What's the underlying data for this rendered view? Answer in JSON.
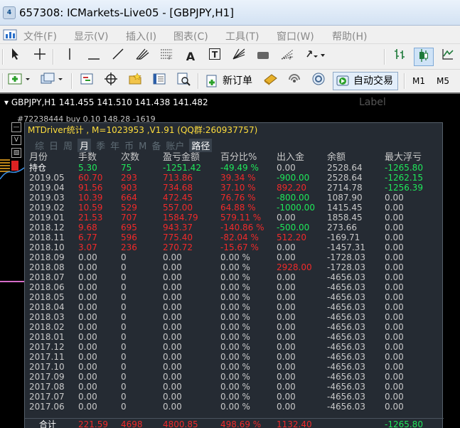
{
  "window": {
    "title": "657308: ICMarkets-Live05 - [GBPJPY,H1]",
    "app_icon_text": "4"
  },
  "menu": {
    "items": [
      "文件(F)",
      "显示(V)",
      "插入(I)",
      "图表(C)",
      "工具(T)",
      "窗口(W)",
      "帮助(H)"
    ]
  },
  "toolbar1": {
    "tools": [
      "cursor",
      "crosshair",
      "vertical-line",
      "horizontal-line",
      "trendline",
      "andrews-pitchfork",
      "fibo-retracement",
      "text",
      "text-label",
      "gann-fan",
      "rectangle",
      "fibo-fan",
      "arrow-menu",
      "bar-chart",
      "candlestick-chart",
      "line-chart"
    ]
  },
  "toolbar2": {
    "new_order_label": "新订单",
    "auto_trading_label": "自动交易",
    "timeframes": [
      "M1",
      "M5"
    ]
  },
  "chart": {
    "symbol_header": "GBPJPY,H1  141.455 141.510 141.438 141.482",
    "watermark": "Label",
    "order_line": "#72238444 buy 0.10          148.28 -1619",
    "ctrl_boxes": [
      "—",
      "V",
      "▧"
    ]
  },
  "panel": {
    "title": "MTDriver统计 , M=1023953 ,V1.91 (QQ群:260937757)",
    "tabs": [
      "综",
      "日",
      "周",
      "月",
      "季",
      "年",
      "币",
      "M",
      "备",
      "账户",
      "路径"
    ],
    "active_tab": "月",
    "columns": [
      "月份",
      "手数",
      "次数",
      "盈亏金额",
      "百分比%",
      "出入金",
      "余额",
      "最大浮亏"
    ],
    "colors": {
      "green": "#1fe85a",
      "red": "#f02a2a",
      "white": "#ffffff",
      "gray": "#c9c9c9"
    },
    "rows": [
      {
        "cells": [
          "持仓",
          "5.30",
          "75",
          "-1251.42",
          "-49.49 %",
          "0.00",
          "2528.64",
          "-1265.80"
        ],
        "colors": [
          "white",
          "green",
          "green",
          "green",
          "green",
          "gray",
          "gray",
          "green"
        ]
      },
      {
        "cells": [
          "2019.05",
          "60.70",
          "293",
          "713.86",
          "39.34 %",
          "-900.00",
          "2528.64",
          "-1262.15"
        ],
        "colors": [
          "gray",
          "red",
          "red",
          "red",
          "red",
          "green",
          "gray",
          "green"
        ]
      },
      {
        "cells": [
          "2019.04",
          "91.56",
          "903",
          "734.68",
          "37.10 %",
          "892.20",
          "2714.78",
          "-1256.39"
        ],
        "colors": [
          "gray",
          "red",
          "red",
          "red",
          "red",
          "red",
          "gray",
          "green"
        ]
      },
      {
        "cells": [
          "2019.03",
          "10.39",
          "664",
          "472.45",
          "76.76 %",
          "-800.00",
          "1087.90",
          "0.00"
        ],
        "colors": [
          "gray",
          "red",
          "red",
          "red",
          "red",
          "green",
          "gray",
          "gray"
        ]
      },
      {
        "cells": [
          "2019.02",
          "10.59",
          "529",
          "557.00",
          "64.88 %",
          "-1000.00",
          "1415.45",
          "0.00"
        ],
        "colors": [
          "gray",
          "red",
          "red",
          "red",
          "red",
          "green",
          "gray",
          "gray"
        ]
      },
      {
        "cells": [
          "2019.01",
          "21.53",
          "707",
          "1584.79",
          "579.11 %",
          "0.00",
          "1858.45",
          "0.00"
        ],
        "colors": [
          "gray",
          "red",
          "red",
          "red",
          "red",
          "gray",
          "gray",
          "gray"
        ]
      },
      {
        "cells": [
          "2018.12",
          "9.68",
          "695",
          "943.37",
          "-140.86 %",
          "-500.00",
          "273.66",
          "0.00"
        ],
        "colors": [
          "gray",
          "red",
          "red",
          "red",
          "red",
          "green",
          "gray",
          "gray"
        ]
      },
      {
        "cells": [
          "2018.11",
          "6.77",
          "596",
          "775.40",
          "-82.04 %",
          "512.20",
          "-169.71",
          "0.00"
        ],
        "colors": [
          "gray",
          "red",
          "red",
          "red",
          "red",
          "red",
          "gray",
          "gray"
        ]
      },
      {
        "cells": [
          "2018.10",
          "3.07",
          "236",
          "270.72",
          "-15.67 %",
          "0.00",
          "-1457.31",
          "0.00"
        ],
        "colors": [
          "gray",
          "red",
          "red",
          "red",
          "red",
          "gray",
          "gray",
          "gray"
        ]
      },
      {
        "cells": [
          "2018.09",
          "0.00",
          "0",
          "0.00",
          "0.00 %",
          "0.00",
          "-1728.03",
          "0.00"
        ],
        "colors": [
          "gray",
          "gray",
          "gray",
          "gray",
          "gray",
          "gray",
          "gray",
          "gray"
        ]
      },
      {
        "cells": [
          "2018.08",
          "0.00",
          "0",
          "0.00",
          "0.00 %",
          "2928.00",
          "-1728.03",
          "0.00"
        ],
        "colors": [
          "gray",
          "gray",
          "gray",
          "gray",
          "gray",
          "red",
          "gray",
          "gray"
        ]
      },
      {
        "cells": [
          "2018.07",
          "0.00",
          "0",
          "0.00",
          "0.00 %",
          "0.00",
          "-4656.03",
          "0.00"
        ],
        "colors": [
          "gray",
          "gray",
          "gray",
          "gray",
          "gray",
          "gray",
          "gray",
          "gray"
        ]
      },
      {
        "cells": [
          "2018.06",
          "0.00",
          "0",
          "0.00",
          "0.00 %",
          "0.00",
          "-4656.03",
          "0.00"
        ],
        "colors": [
          "gray",
          "gray",
          "gray",
          "gray",
          "gray",
          "gray",
          "gray",
          "gray"
        ]
      },
      {
        "cells": [
          "2018.05",
          "0.00",
          "0",
          "0.00",
          "0.00 %",
          "0.00",
          "-4656.03",
          "0.00"
        ],
        "colors": [
          "gray",
          "gray",
          "gray",
          "gray",
          "gray",
          "gray",
          "gray",
          "gray"
        ]
      },
      {
        "cells": [
          "2018.04",
          "0.00",
          "0",
          "0.00",
          "0.00 %",
          "0.00",
          "-4656.03",
          "0.00"
        ],
        "colors": [
          "gray",
          "gray",
          "gray",
          "gray",
          "gray",
          "gray",
          "gray",
          "gray"
        ]
      },
      {
        "cells": [
          "2018.03",
          "0.00",
          "0",
          "0.00",
          "0.00 %",
          "0.00",
          "-4656.03",
          "0.00"
        ],
        "colors": [
          "gray",
          "gray",
          "gray",
          "gray",
          "gray",
          "gray",
          "gray",
          "gray"
        ]
      },
      {
        "cells": [
          "2018.02",
          "0.00",
          "0",
          "0.00",
          "0.00 %",
          "0.00",
          "-4656.03",
          "0.00"
        ],
        "colors": [
          "gray",
          "gray",
          "gray",
          "gray",
          "gray",
          "gray",
          "gray",
          "gray"
        ]
      },
      {
        "cells": [
          "2018.01",
          "0.00",
          "0",
          "0.00",
          "0.00 %",
          "0.00",
          "-4656.03",
          "0.00"
        ],
        "colors": [
          "gray",
          "gray",
          "gray",
          "gray",
          "gray",
          "gray",
          "gray",
          "gray"
        ]
      },
      {
        "cells": [
          "2017.12",
          "0.00",
          "0",
          "0.00",
          "0.00 %",
          "0.00",
          "-4656.03",
          "0.00"
        ],
        "colors": [
          "gray",
          "gray",
          "gray",
          "gray",
          "gray",
          "gray",
          "gray",
          "gray"
        ]
      },
      {
        "cells": [
          "2017.11",
          "0.00",
          "0",
          "0.00",
          "0.00 %",
          "0.00",
          "-4656.03",
          "0.00"
        ],
        "colors": [
          "gray",
          "gray",
          "gray",
          "gray",
          "gray",
          "gray",
          "gray",
          "gray"
        ]
      },
      {
        "cells": [
          "2017.10",
          "0.00",
          "0",
          "0.00",
          "0.00 %",
          "0.00",
          "-4656.03",
          "0.00"
        ],
        "colors": [
          "gray",
          "gray",
          "gray",
          "gray",
          "gray",
          "gray",
          "gray",
          "gray"
        ]
      },
      {
        "cells": [
          "2017.09",
          "0.00",
          "0",
          "0.00",
          "0.00 %",
          "0.00",
          "-4656.03",
          "0.00"
        ],
        "colors": [
          "gray",
          "gray",
          "gray",
          "gray",
          "gray",
          "gray",
          "gray",
          "gray"
        ]
      },
      {
        "cells": [
          "2017.08",
          "0.00",
          "0",
          "0.00",
          "0.00 %",
          "0.00",
          "-4656.03",
          "0.00"
        ],
        "colors": [
          "gray",
          "gray",
          "gray",
          "gray",
          "gray",
          "gray",
          "gray",
          "gray"
        ]
      },
      {
        "cells": [
          "2017.07",
          "0.00",
          "0",
          "0.00",
          "0.00 %",
          "0.00",
          "-4656.03",
          "0.00"
        ],
        "colors": [
          "gray",
          "gray",
          "gray",
          "gray",
          "gray",
          "gray",
          "gray",
          "gray"
        ]
      },
      {
        "cells": [
          "2017.06",
          "0.00",
          "0",
          "0.00",
          "0.00 %",
          "0.00",
          "-4656.03",
          "0.00"
        ],
        "colors": [
          "gray",
          "gray",
          "gray",
          "gray",
          "gray",
          "gray",
          "gray",
          "gray"
        ]
      }
    ],
    "total": {
      "cells": [
        "合计",
        "221.59",
        "4698",
        "4800.85",
        "498.69 %",
        "1132.40",
        "",
        "-1265.80"
      ],
      "colors": [
        "white",
        "red",
        "red",
        "red",
        "red",
        "red",
        "gray",
        "green"
      ]
    }
  }
}
